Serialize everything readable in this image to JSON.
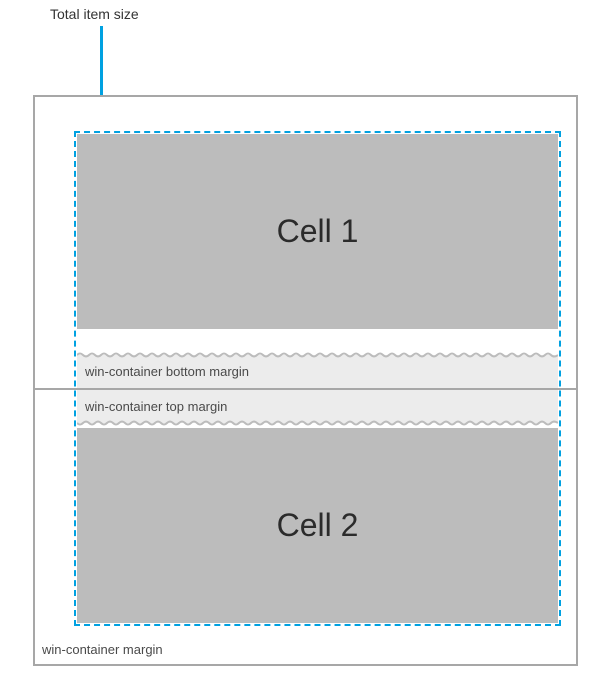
{
  "callout": {
    "label": "Total item size"
  },
  "outer": {
    "caption": "win-container margin"
  },
  "cells": [
    {
      "label": "Cell 1"
    },
    {
      "label": "Cell 2"
    }
  ],
  "margins": {
    "bottom_label": "win-container bottom margin",
    "top_label": "win-container top margin"
  },
  "colors": {
    "accent": "#00a1e1",
    "cell_fill": "#bcbcbc",
    "strip_fill": "#ececec",
    "border": "#a7a7a7"
  }
}
